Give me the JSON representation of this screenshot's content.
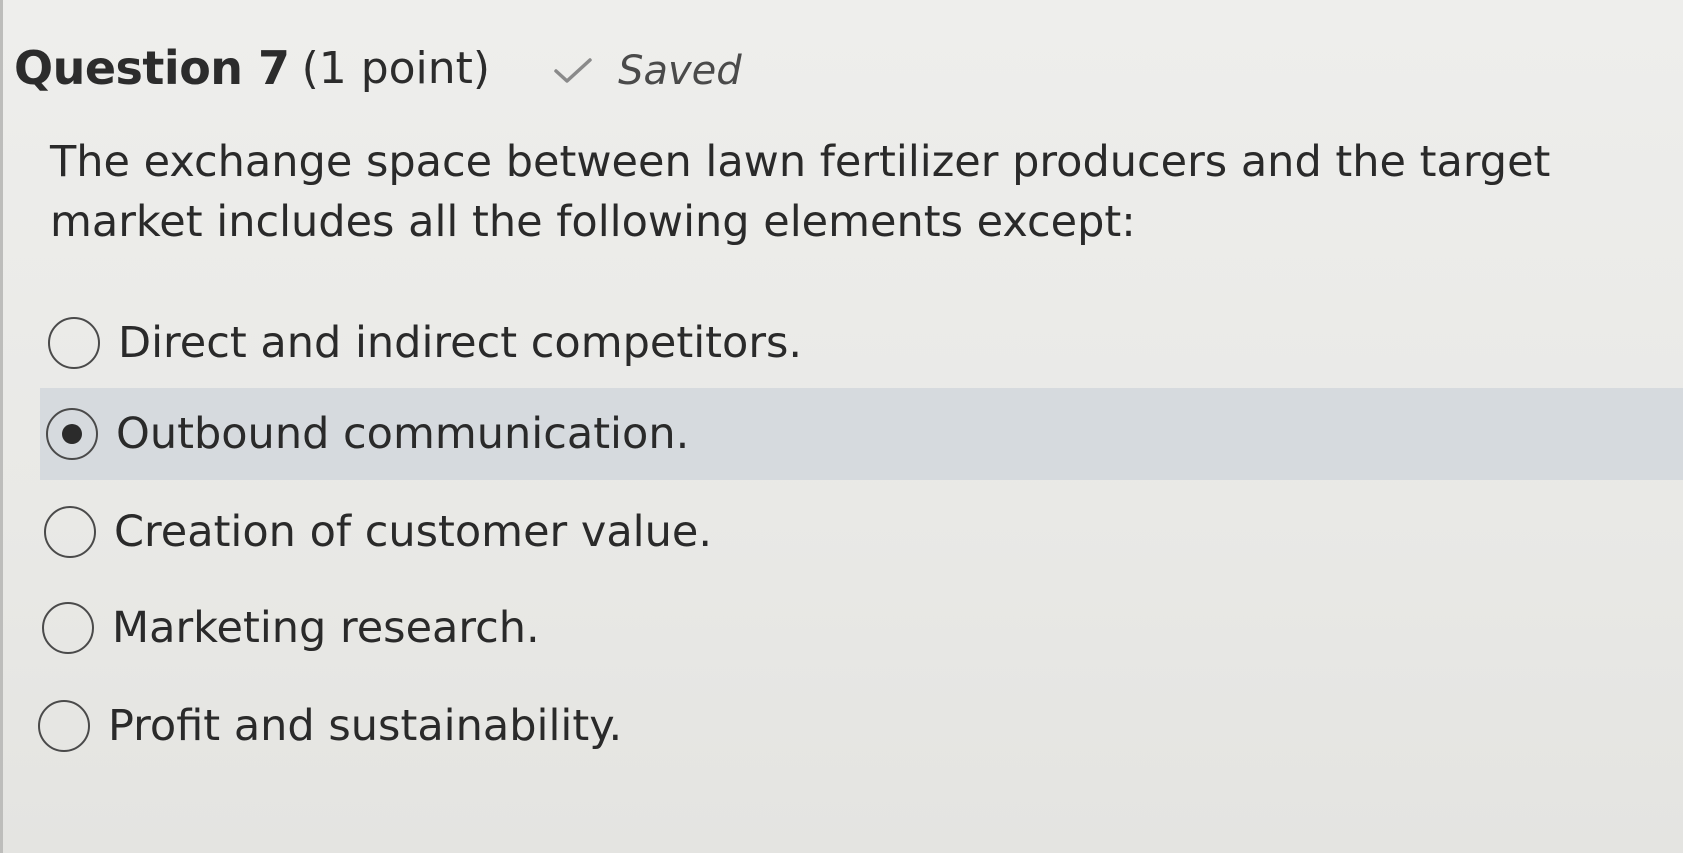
{
  "header": {
    "question_title": "Question 7",
    "points": "(1 point)",
    "status": "Saved"
  },
  "question": {
    "text": "The exchange space between lawn fertilizer producers and the target market includes all the following elements except:"
  },
  "options": [
    {
      "label": "Direct and indirect competitors.",
      "selected": false
    },
    {
      "label": "Outbound communication.",
      "selected": true
    },
    {
      "label": "Creation of customer value.",
      "selected": false
    },
    {
      "label": "Marketing research.",
      "selected": false
    },
    {
      "label": "Profit and sustainability.",
      "selected": false
    }
  ],
  "icons": {
    "saved": "check-icon",
    "radio": "radio-icon"
  },
  "colors": {
    "selected_row_background": "#d6dade",
    "text": "#2a2a2a"
  }
}
